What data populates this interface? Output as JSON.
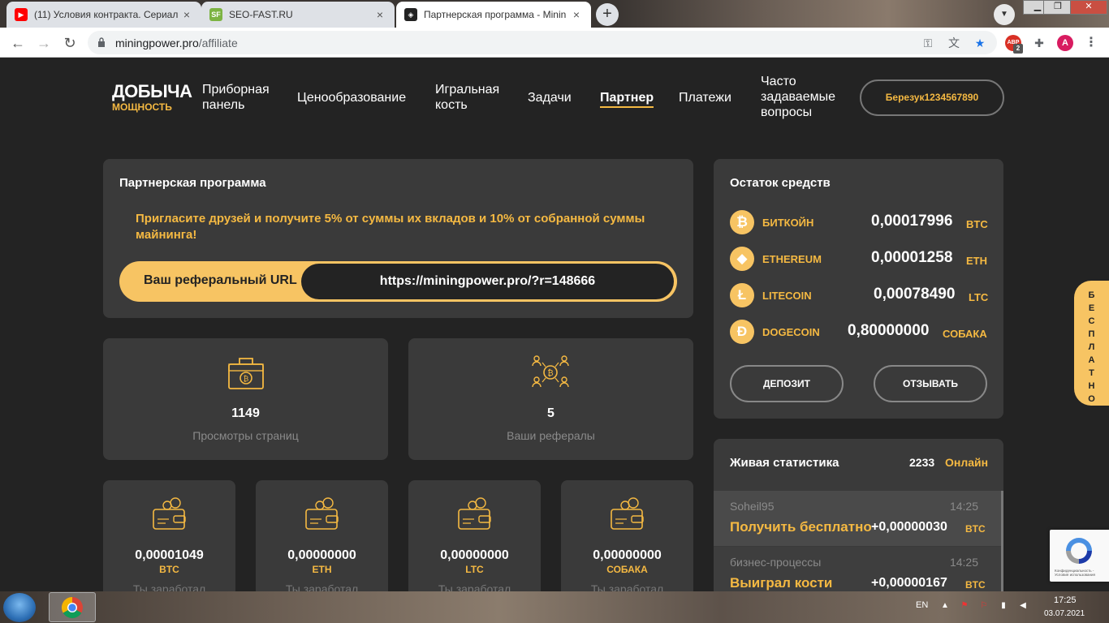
{
  "browser": {
    "tabs": [
      {
        "title": "(11) Условия контракта. Сериал",
        "favicon": "youtube-icon",
        "color": "#ff0000"
      },
      {
        "title": "SEO-FAST.RU",
        "favicon": "sf-icon",
        "color": "#7cb342",
        "favicon_text": "SF"
      },
      {
        "title": "Партнерская программа - Minin",
        "favicon": "miningpower-icon",
        "color": "#222222"
      }
    ],
    "url_host": "miningpower.pro",
    "url_path": "/affiliate",
    "profile_initial": "A",
    "ext_badge": "2",
    "ext_abp": "ABP"
  },
  "site": {
    "logo_main": "ДОБЫЧА",
    "logo_sub": "МОЩНОСТЬ",
    "nav": {
      "dashboard_1": "Приборная",
      "dashboard_2": "панель",
      "pricing": "Ценообразование",
      "dice_1": "Игральная",
      "dice_2": "кость",
      "tasks": "Задачи",
      "partner": "Партнер",
      "payments": "Платежи",
      "faq_1": "Часто",
      "faq_2": "задаваемые",
      "faq_3": "вопросы"
    },
    "user_name": "Березук1234567890",
    "affiliate": {
      "title": "Партнерская программа",
      "invite_text": "Пригласите друзей и получите 5% от суммы их вкладов и 10% от собранной суммы майнинга!",
      "ref_label": "Ваш реферальный URL",
      "ref_url": "https://miningpower.pro/?r=148666"
    },
    "stats": {
      "views_value": "1149",
      "views_label": "Просмотры страниц",
      "refs_value": "5",
      "refs_label": "Ваши рефералы"
    },
    "earnings": [
      {
        "value": "0,00001049",
        "symbol": "BTC",
        "label": "Ты заработал"
      },
      {
        "value": "0,00000000",
        "symbol": "ETH",
        "label": "Ты заработал"
      },
      {
        "value": "0,00000000",
        "symbol": "LTC",
        "label": "Ты заработал"
      },
      {
        "value": "0,00000000",
        "symbol": "СОБАКА",
        "label": "Ты заработал"
      }
    ],
    "balance": {
      "title": "Остаток средств",
      "rows": [
        {
          "name": "БИТКОЙН",
          "amount": "0,00017996",
          "cur": "BTC",
          "icon": "bitcoin-icon",
          "glyph": "₿"
        },
        {
          "name": "ETHEREUM",
          "amount": "0,00001258",
          "cur": "ETH",
          "icon": "ethereum-icon",
          "glyph": "◆"
        },
        {
          "name": "LITECOIN",
          "amount": "0,00078490",
          "cur": "LTC",
          "icon": "litecoin-icon",
          "glyph": "Ł"
        },
        {
          "name": "DOGECOIN",
          "amount": "0,80000000",
          "cur": "СОБАКА",
          "icon": "dogecoin-icon",
          "glyph": "Ð"
        }
      ],
      "deposit": "ДЕПОЗИТ",
      "withdraw": "ОТЗЫВАТЬ"
    },
    "live": {
      "title": "Живая статистика",
      "online_count": "2233",
      "online_label": "Онлайн",
      "rows": [
        {
          "user": "Soheil95",
          "time": "14:25",
          "action": "Получить бесплатно",
          "amount": "+0,00000030",
          "cur": "BTC"
        },
        {
          "user": "бизнес-процессы",
          "time": "14:25",
          "action": "Выиграл кости",
          "amount": "+0,00000167",
          "cur": "BTC"
        }
      ]
    },
    "free_tab": [
      "Б",
      "Е",
      "С",
      "П",
      "Л",
      "А",
      "Т",
      "Н",
      "О"
    ],
    "recaptcha_text": "Конфиденциальность - Условия использования"
  },
  "taskbar": {
    "lang": "EN",
    "time": "17:25",
    "date": "03.07.2021"
  },
  "colors": {
    "accent": "#f5b942",
    "bg": "#232323",
    "card": "#3a3a3a"
  }
}
